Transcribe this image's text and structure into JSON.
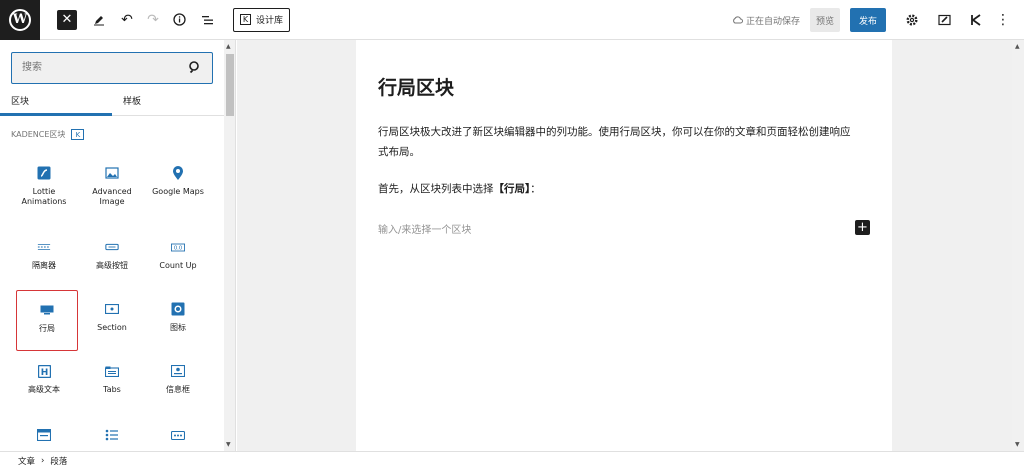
{
  "toolbar": {
    "pattern_library_label": "设计库",
    "pattern_badge": "K",
    "saved_status": "正在自动保存",
    "preview_label": "预览",
    "publish_label": "发布"
  },
  "inserter": {
    "search_placeholder": "搜索",
    "tabs": [
      "区块",
      "样板"
    ],
    "category_label": "KADENCE区块",
    "category_badge": "K",
    "blocks": [
      {
        "label": "Lottie\nAnimations",
        "icon": "lottie-icon"
      },
      {
        "label": "Advanced\nImage",
        "icon": "image-icon"
      },
      {
        "label": "Google Maps",
        "icon": "map-pin-icon"
      },
      {
        "label": "隔离器",
        "icon": "spacer-icon"
      },
      {
        "label": "高级按钮",
        "icon": "button-icon"
      },
      {
        "label": "Count Up",
        "icon": "count-up-icon"
      },
      {
        "label": "行局",
        "icon": "row-layout-icon"
      },
      {
        "label": "Section",
        "icon": "section-icon"
      },
      {
        "label": "图标",
        "icon": "icon-block-icon"
      },
      {
        "label": "高级文本",
        "icon": "heading-icon"
      },
      {
        "label": "Tabs",
        "icon": "tabs-icon"
      },
      {
        "label": "信息框",
        "icon": "info-box-icon"
      },
      {
        "label": "",
        "icon": "form-icon"
      },
      {
        "label": "",
        "icon": "list-icon"
      },
      {
        "label": "",
        "icon": "more-icon"
      }
    ]
  },
  "editor": {
    "title": "行局区块",
    "paragraph1": "行局区块极大改进了新区块编辑器中的列功能。使用行局区块，你可以在你的文章和页面轻松创建响应式布局。",
    "paragraph2_prefix": "首先，从区块列表中选择",
    "paragraph2_bold": "【行局】",
    "paragraph2_suffix": "：",
    "placeholder": "输入/来选择一个区块",
    "add_block_symbol": "+"
  },
  "breadcrumb": {
    "items": [
      "文章",
      "段落"
    ],
    "separator": "›"
  },
  "colors": {
    "accent": "#2271b1",
    "selection": "#d63638",
    "dark": "#1e1e1e"
  }
}
